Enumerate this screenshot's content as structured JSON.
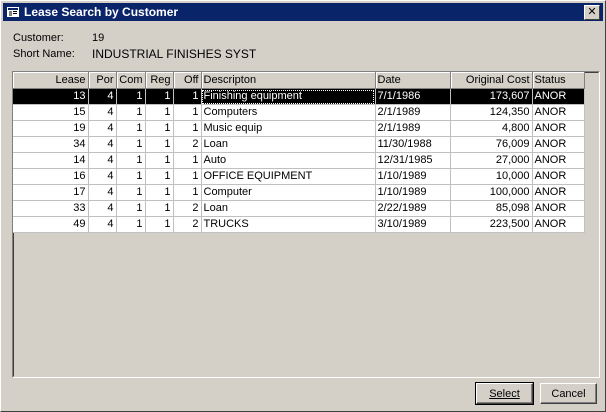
{
  "window": {
    "title": "Lease Search by Customer",
    "close_glyph": "✕"
  },
  "customer": {
    "label": "Customer:",
    "value": "19"
  },
  "short_name": {
    "label": "Short Name:",
    "value": "INDUSTRIAL FINISHES SYST"
  },
  "table": {
    "columns": [
      "Lease",
      "Por",
      "Com",
      "Reg",
      "Off",
      "Descripton",
      "Date",
      "Original Cost",
      "Status"
    ],
    "selected_index": 0,
    "rows": [
      [
        "13",
        "4",
        "1",
        "1",
        "1",
        "Finishing equipment",
        "7/1/1986",
        "173,607",
        "ANOR"
      ],
      [
        "15",
        "4",
        "1",
        "1",
        "1",
        "Computers",
        "2/1/1989",
        "124,350",
        "ANOR"
      ],
      [
        "19",
        "4",
        "1",
        "1",
        "1",
        "Music equip",
        "2/1/1989",
        "4,800",
        "ANOR"
      ],
      [
        "34",
        "4",
        "1",
        "1",
        "2",
        "Loan",
        "11/30/1988",
        "76,009",
        "ANOR"
      ],
      [
        "14",
        "4",
        "1",
        "1",
        "1",
        "Auto",
        "12/31/1985",
        "27,000",
        "ANOR"
      ],
      [
        "16",
        "4",
        "1",
        "1",
        "1",
        "OFFICE EQUIPMENT",
        "1/10/1989",
        "10,000",
        "ANOR"
      ],
      [
        "17",
        "4",
        "1",
        "1",
        "1",
        "Computer",
        "1/10/1989",
        "100,000",
        "ANOR"
      ],
      [
        "33",
        "4",
        "1",
        "1",
        "2",
        "Loan",
        "2/22/1989",
        "85,098",
        "ANOR"
      ],
      [
        "49",
        "4",
        "1",
        "1",
        "2",
        "TRUCKS",
        "3/10/1989",
        "223,500",
        "ANOR"
      ]
    ]
  },
  "buttons": {
    "select": "Select",
    "cancel": "Cancel"
  },
  "colors": {
    "titlebar": "#0a246a",
    "face": "#d4d0c8",
    "selection": "#000000"
  }
}
